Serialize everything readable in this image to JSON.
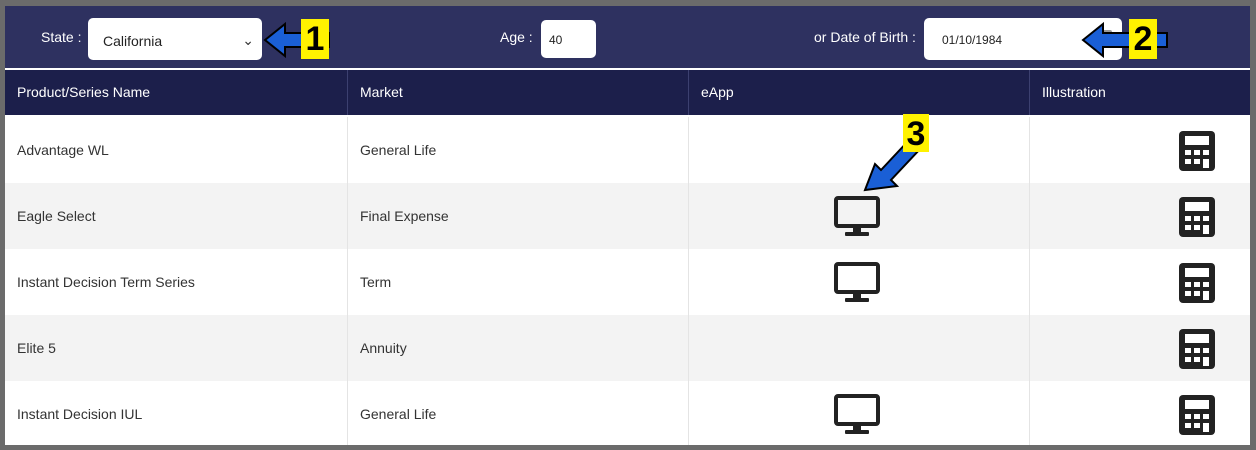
{
  "filters": {
    "state_label": "State :",
    "state_value": "California",
    "age_label": "Age :",
    "age_value": "40",
    "dob_label": "or Date of Birth :",
    "dob_value": "01/10/1984"
  },
  "table": {
    "headers": [
      "Product/Series Name",
      "Market",
      "eApp",
      "Illustration"
    ],
    "rows": [
      {
        "name": "Advantage WL",
        "market": "General Life",
        "eapp": false,
        "illustration": true
      },
      {
        "name": "Eagle Select",
        "market": "Final Expense",
        "eapp": true,
        "illustration": true
      },
      {
        "name": "Instant Decision Term Series",
        "market": "Term",
        "eapp": true,
        "illustration": true
      },
      {
        "name": "Elite 5",
        "market": "Annuity",
        "eapp": false,
        "illustration": true
      },
      {
        "name": "Instant Decision IUL",
        "market": "General Life",
        "eapp": true,
        "illustration": true
      }
    ]
  },
  "annotations": {
    "badge_1": "1",
    "badge_2": "2",
    "badge_3": "3",
    "arrow_color": "#1a5fd6",
    "badge_color": "#fff200"
  },
  "icons": {
    "eapp_icon": "monitor-icon",
    "illustration_icon": "calculator-icon"
  }
}
